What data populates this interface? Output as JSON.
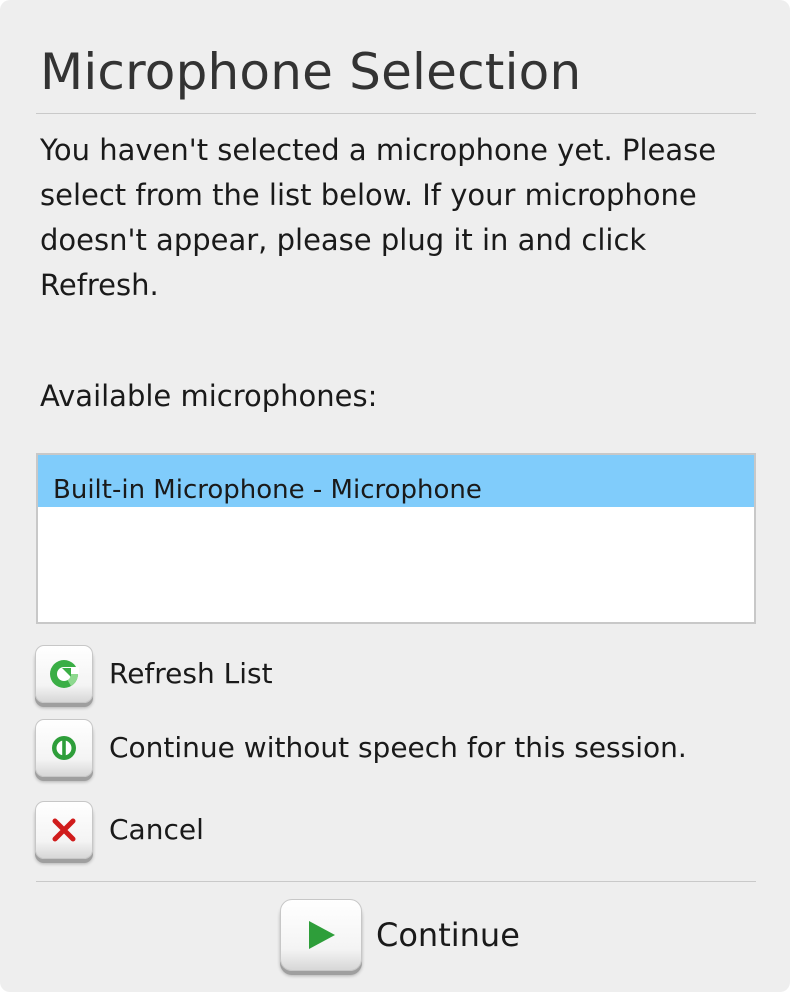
{
  "dialog": {
    "title": "Microphone Selection",
    "intro": "You haven't selected a microphone yet. Please select from the list below. If your microphone doesn't appear, please plug it in and click Refresh.",
    "available_label": "Available microphones:"
  },
  "microphones": {
    "items": [
      {
        "label": "Built-in Microphone - Microphone",
        "selected": true
      }
    ]
  },
  "actions": {
    "refresh_label": "Refresh List",
    "refresh_icon": "refresh-icon",
    "no_speech_label": "Continue without speech for this session.",
    "no_speech_icon": "no-speech-icon",
    "cancel_label": "Cancel",
    "cancel_icon": "close-icon",
    "continue_label": "Continue",
    "continue_icon": "play-icon"
  },
  "colors": {
    "dialog_bg": "#eeeeee",
    "selection": "#80ccfb",
    "icon_green": "#2e9e3a",
    "icon_red": "#d01c1c"
  }
}
